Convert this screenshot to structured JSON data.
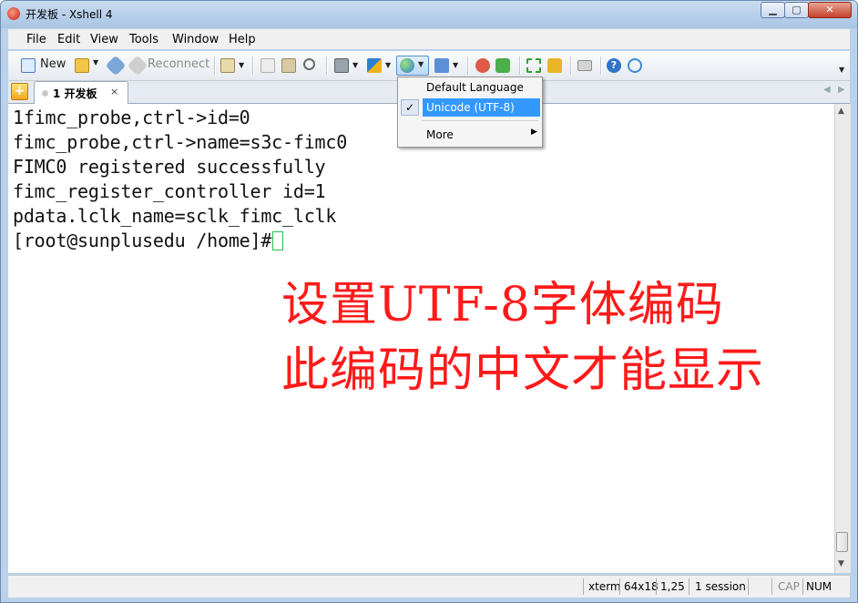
{
  "window": {
    "title": "开发板 - Xshell 4"
  },
  "menubar": {
    "items": [
      "File",
      "Edit",
      "View",
      "Tools",
      "Window",
      "Help"
    ]
  },
  "toolbar": {
    "new_label": "New",
    "reconnect_label": "Reconnect"
  },
  "tabs": [
    {
      "label": "1 开发板",
      "close": "×"
    }
  ],
  "terminal": {
    "lines": [
      "1fimc_probe,ctrl->id=0",
      "fimc_probe,ctrl->name=s3c-fimc0",
      "FIMC0 registered successfully",
      "fimc_register_controller id=1",
      "pdata.lclk_name=sclk_fimc_lclk",
      "[root@sunplusedu /home]#"
    ]
  },
  "annotation": {
    "line1": "设置UTF-8字体编码",
    "line2": "此编码的中文才能显示"
  },
  "encoding_menu": {
    "items": [
      {
        "label": "Default Language",
        "checked": false
      },
      {
        "label": "Unicode (UTF-8)",
        "checked": true
      },
      {
        "label": "More",
        "submenu": true
      }
    ]
  },
  "statusbar": {
    "term": "xterm",
    "size": "64x18",
    "pos": "1,25",
    "sessions": "1 session",
    "cap": "CAP",
    "num": "NUM"
  },
  "colors": {
    "annotation": "#ff1a1a",
    "cursor": "#22c04a",
    "menu_highlight": "#3399ff"
  }
}
